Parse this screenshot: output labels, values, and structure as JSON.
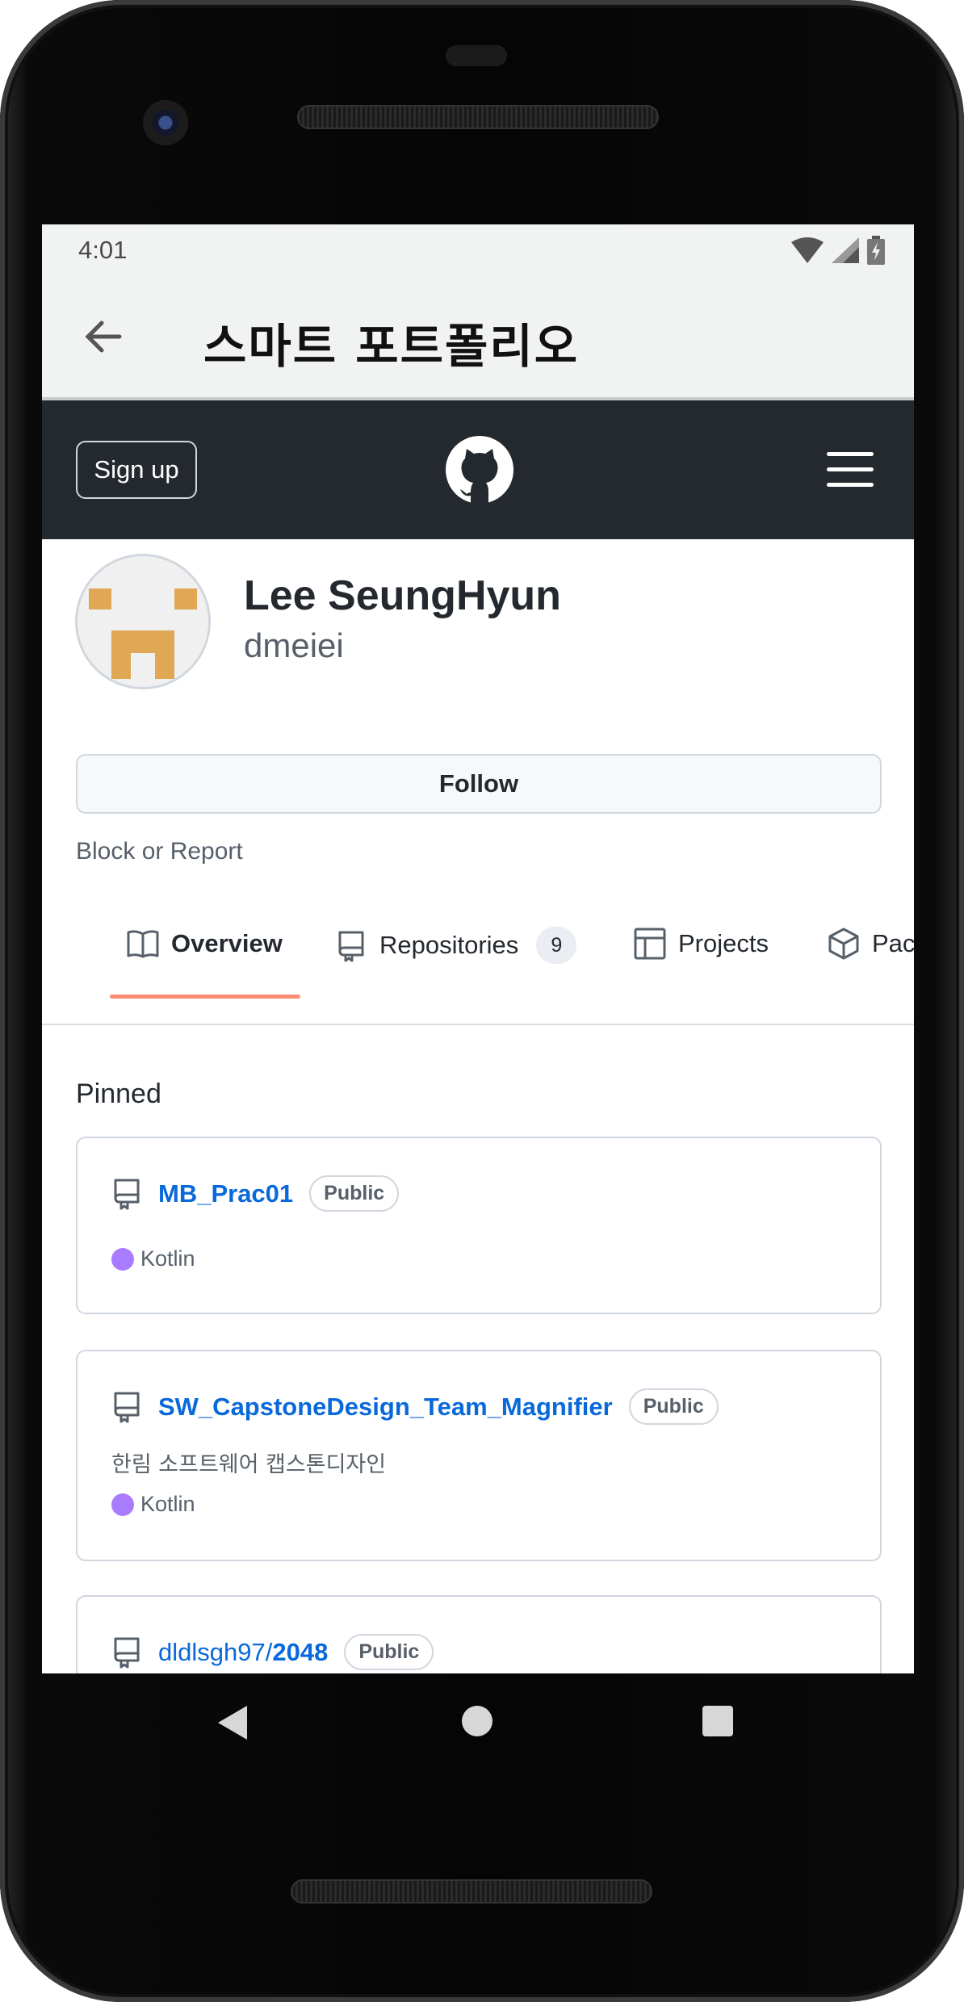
{
  "status_bar": {
    "time": "4:01",
    "icons": [
      "wifi-icon",
      "signal-icon",
      "battery-charging-icon"
    ]
  },
  "app_bar": {
    "back_icon": "arrow-left-icon",
    "title": "스마트 포트폴리오"
  },
  "github_header": {
    "signup_label": "Sign up",
    "logo_icon": "github-logo-icon",
    "menu_icon": "hamburger-menu-icon"
  },
  "profile": {
    "name": "Lee SeungHyun",
    "login": "dmeiei",
    "follow_label": "Follow",
    "block_label": "Block or Report"
  },
  "tabs": [
    {
      "label": "Overview",
      "icon": "book-icon",
      "selected": true
    },
    {
      "label": "Repositories",
      "icon": "repo-icon",
      "count": "9"
    },
    {
      "label": "Projects",
      "icon": "table-icon"
    },
    {
      "label": "Pac",
      "icon": "package-icon"
    }
  ],
  "pinned": {
    "label": "Pinned",
    "repos": [
      {
        "name": "MB_Prac01",
        "visibility": "Public",
        "description": "",
        "language": "Kotlin",
        "language_color": "#A97BFF"
      },
      {
        "name": "SW_CapstoneDesign_Team_Magnifier",
        "visibility": "Public",
        "description": "한림 소프트웨어 캡스톤디자인",
        "language": "Kotlin",
        "language_color": "#A97BFF"
      },
      {
        "owner": "dldlsgh97/",
        "name": "2048",
        "visibility": "Public"
      }
    ]
  },
  "colors": {
    "header_bg": "#24292F",
    "link": "#0969DA",
    "tab_underline": "#FD8C73",
    "app_bar_bg": "#F1F3F2"
  }
}
